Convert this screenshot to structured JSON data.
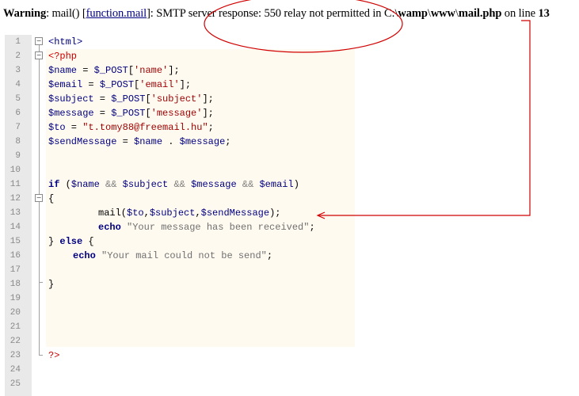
{
  "warning": {
    "label": "Warning",
    "text1": ": mail() [",
    "link": "function.mail",
    "text2": "]: SMTP server response: 550 relay not permitted in C:\\",
    "p1": "wamp",
    "sep1": "\\",
    "p2": "www",
    "sep2": "\\",
    "p3": "mail.php",
    "text3": " on line ",
    "line": "13"
  },
  "line_numbers": [
    "1",
    "2",
    "3",
    "4",
    "5",
    "6",
    "7",
    "8",
    "9",
    "10",
    "11",
    "12",
    "13",
    "14",
    "15",
    "16",
    "17",
    "18",
    "19",
    "20",
    "21",
    "22",
    "23",
    "24",
    "25"
  ],
  "code": {
    "l1": "<html>",
    "l2": "<?php",
    "l3a": "$name",
    "l3b": " = ",
    "l3c": "$_POST",
    "l3d": "[",
    "l3e": "'name'",
    "l3f": "];",
    "l4a": "$email",
    "l4b": " = ",
    "l4c": "$_POST",
    "l4d": "[",
    "l4e": "'email'",
    "l4f": "];",
    "l5a": "$subject",
    "l5b": " = ",
    "l5c": "$_POST",
    "l5d": "[",
    "l5e": "'subject'",
    "l5f": "];",
    "l6a": "$message",
    "l6b": " = ",
    "l6c": "$_POST",
    "l6d": "[",
    "l6e": "'message'",
    "l6f": "];",
    "l7a": "$to",
    "l7b": " = ",
    "l7c": "\"t.tomy88@freemail.hu\"",
    "l7d": ";",
    "l8a": "$sendMessage",
    "l8b": " = ",
    "l8c": "$name",
    "l8d": " . ",
    "l8e": "$message",
    "l8f": ";",
    "l11a": "if",
    "l11b": " (",
    "l11c": "$name",
    "l11d": " && ",
    "l11e": "$subject",
    "l11f": " && ",
    "l11g": "$message",
    "l11h": " && ",
    "l11i": "$email",
    "l11j": ")",
    "l12": "{",
    "l13a": "mail(",
    "l13b": "$to",
    "l13c": ",",
    "l13d": "$subject",
    "l13e": ",",
    "l13f": "$sendMessage",
    "l13g": ");",
    "l14a": "echo",
    "l14b": " \"Your message has been received\"",
    "l14c": ";",
    "l15a": "} ",
    "l15b": "else",
    "l15c": " {",
    "l16a": "echo",
    "l16b": " \"Your mail could not be send\"",
    "l16c": ";",
    "l18": "}",
    "l23": "?>"
  },
  "fold": {
    "minus": "−"
  },
  "colors": {
    "annotation": "#d00000"
  }
}
